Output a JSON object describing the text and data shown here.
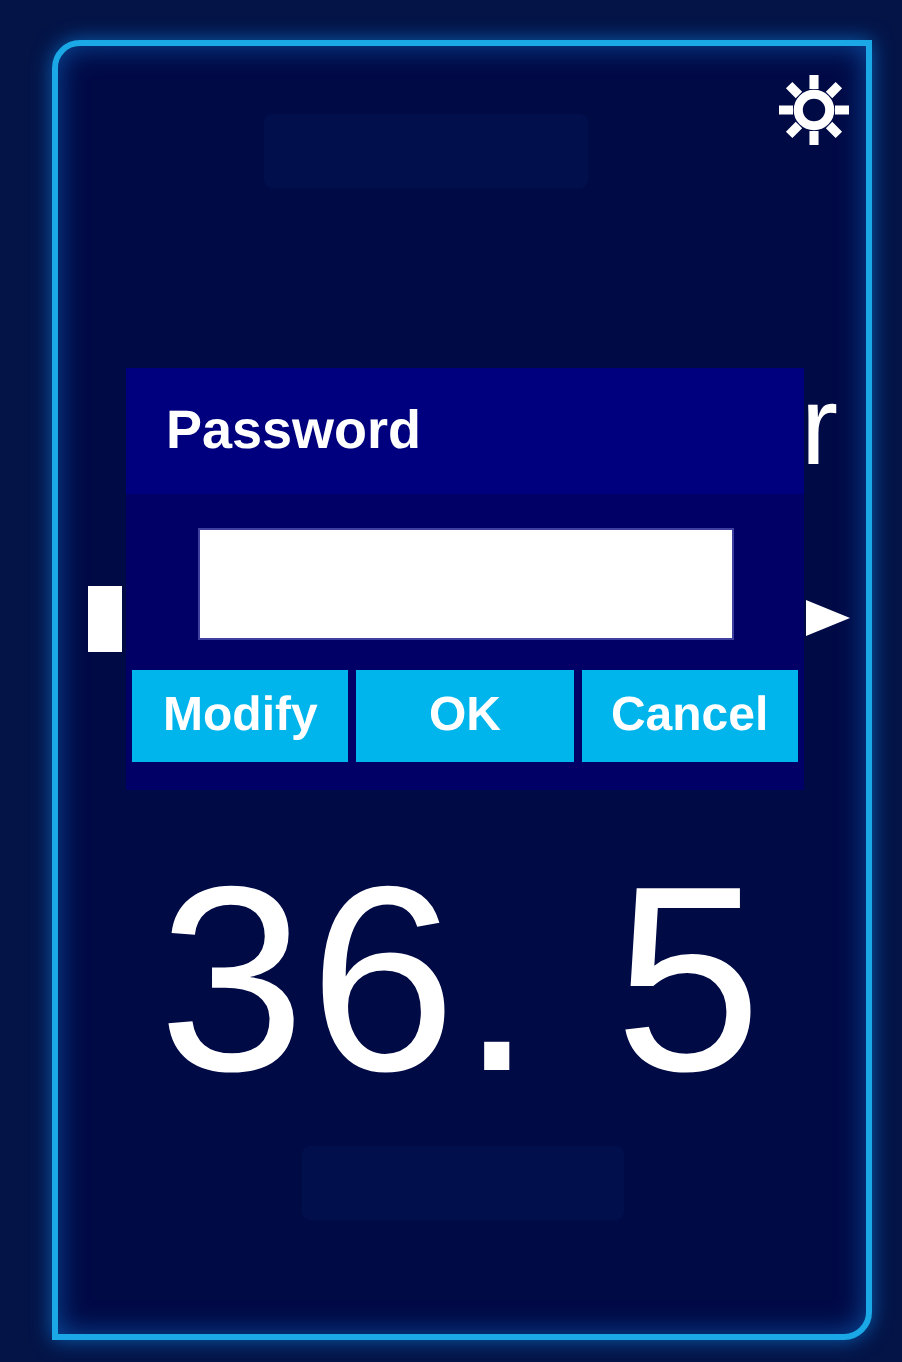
{
  "background_title": {
    "right_fragment": "r"
  },
  "dialog": {
    "title": "Password",
    "buttons": [
      {
        "label": "Modify"
      },
      {
        "label": "OK"
      },
      {
        "label": "Cancel"
      }
    ]
  },
  "reading": "36. 5"
}
